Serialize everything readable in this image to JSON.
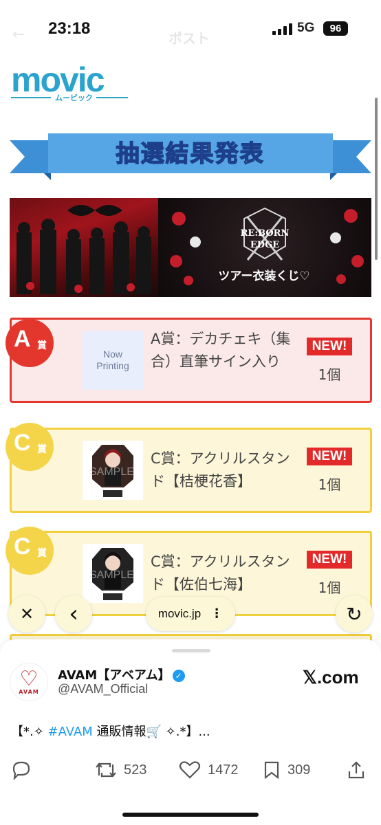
{
  "status_bar": {
    "time": "23:18",
    "network": "5G",
    "battery": "96",
    "ghost_title": "ポスト"
  },
  "logo": {
    "word": "movic",
    "kana": "ムービック"
  },
  "banner": {
    "title": "抽選結果発表"
  },
  "hero": {
    "caption": "ツアー衣装くじ♡"
  },
  "cards": [
    {
      "grade": "A",
      "grade_suffix": "賞",
      "thumb_text": "Now\nPrinting",
      "desc": "A賞：デカチェキ（集合）直筆サイン入り",
      "badge": "NEW!",
      "qty": "1個"
    },
    {
      "grade": "C",
      "grade_suffix": "賞",
      "thumb_text": "",
      "desc": "C賞：アクリルスタンド【桔梗花香】",
      "badge": "NEW!",
      "qty": "1個"
    },
    {
      "grade": "C",
      "grade_suffix": "賞",
      "thumb_text": "",
      "desc": "C賞：アクリルスタンド【佐伯七海】",
      "badge": "NEW!",
      "qty": "1個"
    }
  ],
  "browser": {
    "url": "movic.jp",
    "close_glyph": "✕",
    "back_glyph": "‹",
    "reload_glyph": "↻",
    "more_glyph": "⋮"
  },
  "post": {
    "author_name": "AVAM【アベアム】",
    "handle": "@AVAM_Official",
    "avatar_tag": "AVAM",
    "site": "𝕏.com",
    "text_before": "【*.✧ ",
    "hashtag": "#AVAM",
    "text_after": " 通販情報🛒 ✧.*】...",
    "replies": "",
    "reposts": "523",
    "likes": "1472",
    "bookmarks": "309"
  }
}
